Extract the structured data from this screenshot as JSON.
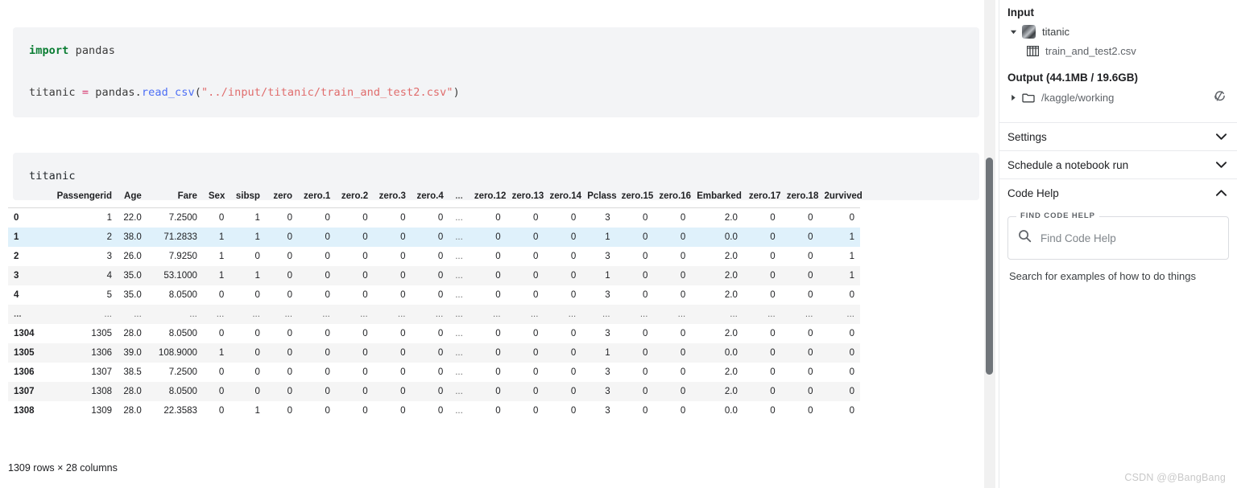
{
  "notebook": {
    "code_cell": {
      "line1": {
        "kw": "import",
        "rest": " pandas"
      },
      "line2": {
        "var": "titanic ",
        "op": "=",
        "mod": " pandas",
        "dot": ".",
        "fn": "read_csv",
        "open": "(",
        "str": "\"../input/titanic/train_and_test2.csv\"",
        "close": ")"
      }
    },
    "output_cell": {
      "text": "titanic"
    },
    "footer": "1309 rows × 28 columns"
  },
  "table": {
    "index_header": "",
    "columns": [
      "Passengerid",
      "Age",
      "Fare",
      "Sex",
      "sibsp",
      "zero",
      "zero.1",
      "zero.2",
      "zero.3",
      "zero.4",
      "...",
      "zero.12",
      "zero.13",
      "zero.14",
      "Pclass",
      "zero.15",
      "zero.16",
      "Embarked",
      "zero.17",
      "zero.18",
      "2urvived"
    ],
    "rows": [
      {
        "index": "0",
        "highlight": false,
        "cells": [
          "1",
          "22.0",
          "7.2500",
          "0",
          "1",
          "0",
          "0",
          "0",
          "0",
          "0",
          "...",
          "0",
          "0",
          "0",
          "3",
          "0",
          "0",
          "2.0",
          "0",
          "0",
          "0"
        ]
      },
      {
        "index": "1",
        "highlight": true,
        "cells": [
          "2",
          "38.0",
          "71.2833",
          "1",
          "1",
          "0",
          "0",
          "0",
          "0",
          "0",
          "...",
          "0",
          "0",
          "0",
          "1",
          "0",
          "0",
          "0.0",
          "0",
          "0",
          "1"
        ]
      },
      {
        "index": "2",
        "highlight": false,
        "cells": [
          "3",
          "26.0",
          "7.9250",
          "1",
          "0",
          "0",
          "0",
          "0",
          "0",
          "0",
          "...",
          "0",
          "0",
          "0",
          "3",
          "0",
          "0",
          "2.0",
          "0",
          "0",
          "1"
        ]
      },
      {
        "index": "3",
        "highlight": false,
        "cells": [
          "4",
          "35.0",
          "53.1000",
          "1",
          "1",
          "0",
          "0",
          "0",
          "0",
          "0",
          "...",
          "0",
          "0",
          "0",
          "1",
          "0",
          "0",
          "2.0",
          "0",
          "0",
          "1"
        ]
      },
      {
        "index": "4",
        "highlight": false,
        "cells": [
          "5",
          "35.0",
          "8.0500",
          "0",
          "0",
          "0",
          "0",
          "0",
          "0",
          "0",
          "...",
          "0",
          "0",
          "0",
          "3",
          "0",
          "0",
          "2.0",
          "0",
          "0",
          "0"
        ]
      },
      {
        "index": "...",
        "highlight": false,
        "cells": [
          "...",
          "...",
          "...",
          "...",
          "...",
          "...",
          "...",
          "...",
          "...",
          "...",
          "...",
          "...",
          "...",
          "...",
          "...",
          "...",
          "...",
          "...",
          "...",
          "...",
          "..."
        ]
      },
      {
        "index": "1304",
        "highlight": false,
        "cells": [
          "1305",
          "28.0",
          "8.0500",
          "0",
          "0",
          "0",
          "0",
          "0",
          "0",
          "0",
          "...",
          "0",
          "0",
          "0",
          "3",
          "0",
          "0",
          "2.0",
          "0",
          "0",
          "0"
        ]
      },
      {
        "index": "1305",
        "highlight": false,
        "cells": [
          "1306",
          "39.0",
          "108.9000",
          "1",
          "0",
          "0",
          "0",
          "0",
          "0",
          "0",
          "...",
          "0",
          "0",
          "0",
          "1",
          "0",
          "0",
          "0.0",
          "0",
          "0",
          "0"
        ]
      },
      {
        "index": "1306",
        "highlight": false,
        "cells": [
          "1307",
          "38.5",
          "7.2500",
          "0",
          "0",
          "0",
          "0",
          "0",
          "0",
          "0",
          "...",
          "0",
          "0",
          "0",
          "3",
          "0",
          "0",
          "2.0",
          "0",
          "0",
          "0"
        ]
      },
      {
        "index": "1307",
        "highlight": false,
        "cells": [
          "1308",
          "28.0",
          "8.0500",
          "0",
          "0",
          "0",
          "0",
          "0",
          "0",
          "0",
          "...",
          "0",
          "0",
          "0",
          "3",
          "0",
          "0",
          "2.0",
          "0",
          "0",
          "0"
        ]
      },
      {
        "index": "1308",
        "highlight": false,
        "cells": [
          "1309",
          "28.0",
          "22.3583",
          "0",
          "1",
          "0",
          "0",
          "0",
          "0",
          "0",
          "...",
          "0",
          "0",
          "0",
          "3",
          "0",
          "0",
          "0.0",
          "0",
          "0",
          "0"
        ]
      }
    ]
  },
  "sidebar": {
    "input": {
      "title": "Input",
      "dataset": "titanic",
      "file": "train_and_test2.csv"
    },
    "output": {
      "title": "Output (44.1MB / 19.6GB)",
      "path": "/kaggle/working"
    },
    "accordions": [
      {
        "label": "Settings",
        "expanded": false
      },
      {
        "label": "Schedule a notebook run",
        "expanded": false
      },
      {
        "label": "Code Help",
        "expanded": true
      }
    ],
    "code_help": {
      "legend": "FIND CODE HELP",
      "search_placeholder": "Find Code Help",
      "search_value": "",
      "hint": "Search for examples of how to do things"
    }
  },
  "watermark": "CSDN @@BangBang",
  "colors": {
    "highlight_row": "#dff1fb",
    "stripe": "#f5f5f5",
    "cell_bg": "#f3f4f6",
    "scrollbar": "#70757a"
  }
}
